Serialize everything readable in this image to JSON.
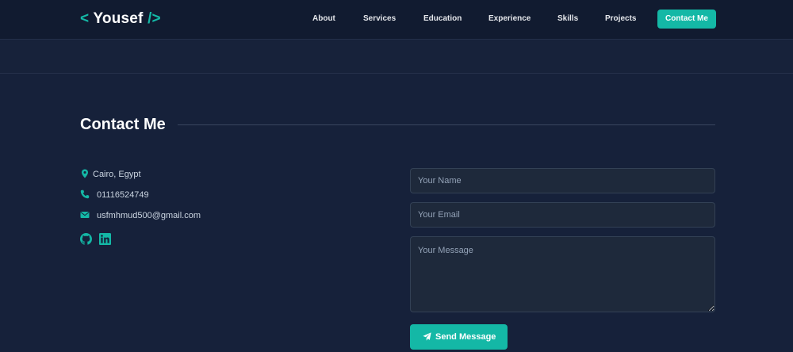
{
  "navbar": {
    "logo": {
      "open": "<",
      "name": "Yousef",
      "close": "/>"
    },
    "links": [
      "About",
      "Services",
      "Education",
      "Experience",
      "Skills",
      "Projects"
    ],
    "cta": "Contact Me"
  },
  "contact": {
    "title": "Contact Me",
    "location": "Cairo, Egypt",
    "phone": "01116524749",
    "email": "usfmhmud500@gmail.com",
    "socials": [
      "github-icon",
      "linkedin-icon"
    ]
  },
  "form": {
    "name_placeholder": "Your Name",
    "email_placeholder": "Your Email",
    "message_placeholder": "Your Message",
    "submit_label": "Send Message"
  },
  "colors": {
    "accent": "#14b8a6",
    "background": "#16213a",
    "navbar": "#111b30",
    "input_bg": "#1e293b"
  }
}
